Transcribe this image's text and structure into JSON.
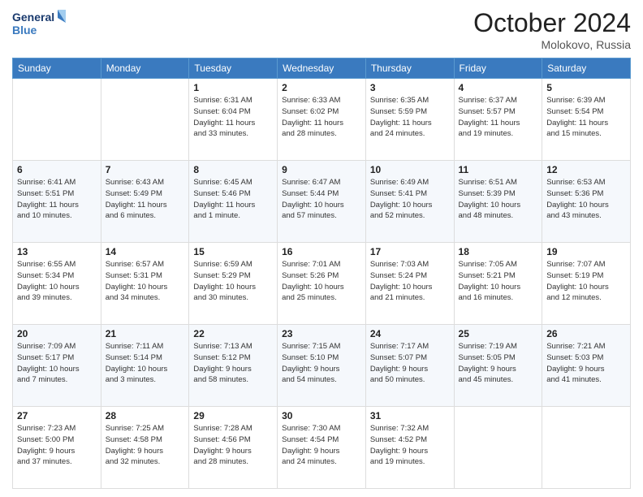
{
  "header": {
    "logo_line1": "General",
    "logo_line2": "Blue",
    "month": "October 2024",
    "location": "Molokovo, Russia"
  },
  "days_of_week": [
    "Sunday",
    "Monday",
    "Tuesday",
    "Wednesday",
    "Thursday",
    "Friday",
    "Saturday"
  ],
  "weeks": [
    [
      {
        "day": "",
        "info": ""
      },
      {
        "day": "",
        "info": ""
      },
      {
        "day": "1",
        "info": "Sunrise: 6:31 AM\nSunset: 6:04 PM\nDaylight: 11 hours\nand 33 minutes."
      },
      {
        "day": "2",
        "info": "Sunrise: 6:33 AM\nSunset: 6:02 PM\nDaylight: 11 hours\nand 28 minutes."
      },
      {
        "day": "3",
        "info": "Sunrise: 6:35 AM\nSunset: 5:59 PM\nDaylight: 11 hours\nand 24 minutes."
      },
      {
        "day": "4",
        "info": "Sunrise: 6:37 AM\nSunset: 5:57 PM\nDaylight: 11 hours\nand 19 minutes."
      },
      {
        "day": "5",
        "info": "Sunrise: 6:39 AM\nSunset: 5:54 PM\nDaylight: 11 hours\nand 15 minutes."
      }
    ],
    [
      {
        "day": "6",
        "info": "Sunrise: 6:41 AM\nSunset: 5:51 PM\nDaylight: 11 hours\nand 10 minutes."
      },
      {
        "day": "7",
        "info": "Sunrise: 6:43 AM\nSunset: 5:49 PM\nDaylight: 11 hours\nand 6 minutes."
      },
      {
        "day": "8",
        "info": "Sunrise: 6:45 AM\nSunset: 5:46 PM\nDaylight: 11 hours\nand 1 minute."
      },
      {
        "day": "9",
        "info": "Sunrise: 6:47 AM\nSunset: 5:44 PM\nDaylight: 10 hours\nand 57 minutes."
      },
      {
        "day": "10",
        "info": "Sunrise: 6:49 AM\nSunset: 5:41 PM\nDaylight: 10 hours\nand 52 minutes."
      },
      {
        "day": "11",
        "info": "Sunrise: 6:51 AM\nSunset: 5:39 PM\nDaylight: 10 hours\nand 48 minutes."
      },
      {
        "day": "12",
        "info": "Sunrise: 6:53 AM\nSunset: 5:36 PM\nDaylight: 10 hours\nand 43 minutes."
      }
    ],
    [
      {
        "day": "13",
        "info": "Sunrise: 6:55 AM\nSunset: 5:34 PM\nDaylight: 10 hours\nand 39 minutes."
      },
      {
        "day": "14",
        "info": "Sunrise: 6:57 AM\nSunset: 5:31 PM\nDaylight: 10 hours\nand 34 minutes."
      },
      {
        "day": "15",
        "info": "Sunrise: 6:59 AM\nSunset: 5:29 PM\nDaylight: 10 hours\nand 30 minutes."
      },
      {
        "day": "16",
        "info": "Sunrise: 7:01 AM\nSunset: 5:26 PM\nDaylight: 10 hours\nand 25 minutes."
      },
      {
        "day": "17",
        "info": "Sunrise: 7:03 AM\nSunset: 5:24 PM\nDaylight: 10 hours\nand 21 minutes."
      },
      {
        "day": "18",
        "info": "Sunrise: 7:05 AM\nSunset: 5:21 PM\nDaylight: 10 hours\nand 16 minutes."
      },
      {
        "day": "19",
        "info": "Sunrise: 7:07 AM\nSunset: 5:19 PM\nDaylight: 10 hours\nand 12 minutes."
      }
    ],
    [
      {
        "day": "20",
        "info": "Sunrise: 7:09 AM\nSunset: 5:17 PM\nDaylight: 10 hours\nand 7 minutes."
      },
      {
        "day": "21",
        "info": "Sunrise: 7:11 AM\nSunset: 5:14 PM\nDaylight: 10 hours\nand 3 minutes."
      },
      {
        "day": "22",
        "info": "Sunrise: 7:13 AM\nSunset: 5:12 PM\nDaylight: 9 hours\nand 58 minutes."
      },
      {
        "day": "23",
        "info": "Sunrise: 7:15 AM\nSunset: 5:10 PM\nDaylight: 9 hours\nand 54 minutes."
      },
      {
        "day": "24",
        "info": "Sunrise: 7:17 AM\nSunset: 5:07 PM\nDaylight: 9 hours\nand 50 minutes."
      },
      {
        "day": "25",
        "info": "Sunrise: 7:19 AM\nSunset: 5:05 PM\nDaylight: 9 hours\nand 45 minutes."
      },
      {
        "day": "26",
        "info": "Sunrise: 7:21 AM\nSunset: 5:03 PM\nDaylight: 9 hours\nand 41 minutes."
      }
    ],
    [
      {
        "day": "27",
        "info": "Sunrise: 7:23 AM\nSunset: 5:00 PM\nDaylight: 9 hours\nand 37 minutes."
      },
      {
        "day": "28",
        "info": "Sunrise: 7:25 AM\nSunset: 4:58 PM\nDaylight: 9 hours\nand 32 minutes."
      },
      {
        "day": "29",
        "info": "Sunrise: 7:28 AM\nSunset: 4:56 PM\nDaylight: 9 hours\nand 28 minutes."
      },
      {
        "day": "30",
        "info": "Sunrise: 7:30 AM\nSunset: 4:54 PM\nDaylight: 9 hours\nand 24 minutes."
      },
      {
        "day": "31",
        "info": "Sunrise: 7:32 AM\nSunset: 4:52 PM\nDaylight: 9 hours\nand 19 minutes."
      },
      {
        "day": "",
        "info": ""
      },
      {
        "day": "",
        "info": ""
      }
    ]
  ]
}
